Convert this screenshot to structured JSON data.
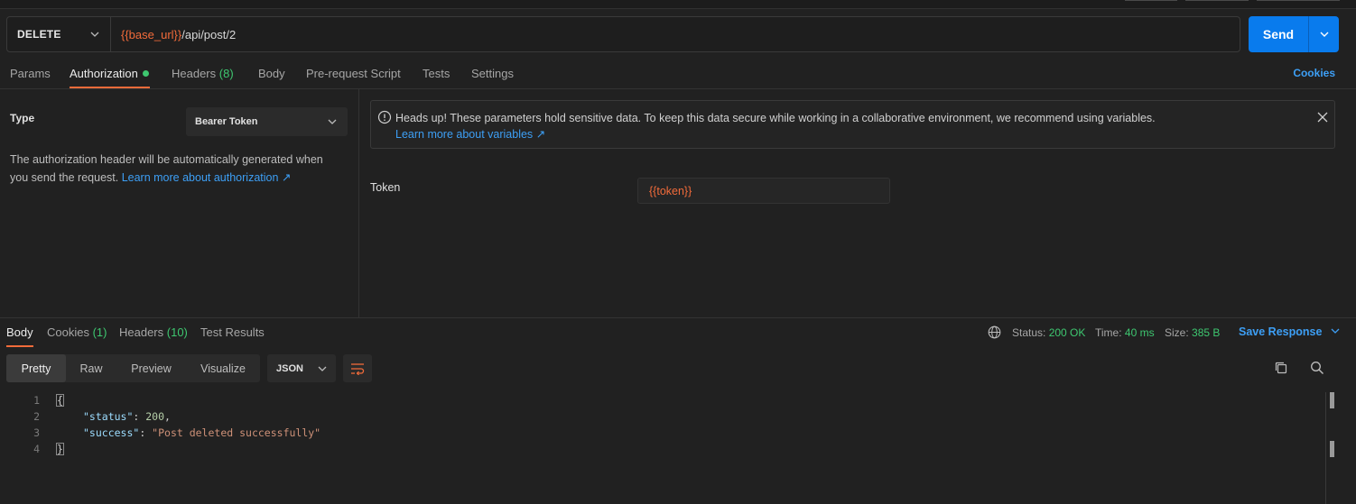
{
  "request": {
    "method": "DELETE",
    "url_var": "{{base_url}}",
    "url_path": "/api/post/2",
    "send_label": "Send"
  },
  "request_tabs": [
    {
      "label": "Params"
    },
    {
      "label": "Authorization"
    },
    {
      "label": "Headers",
      "count": "(8)"
    },
    {
      "label": "Body"
    },
    {
      "label": "Pre-request Script"
    },
    {
      "label": "Tests"
    },
    {
      "label": "Settings"
    }
  ],
  "cookies_link": "Cookies",
  "auth": {
    "type_label": "Type",
    "type_value": "Bearer Token",
    "description": "The authorization header will be automatically generated when you send the request. ",
    "learn_link": "Learn more about authorization ↗",
    "alert_text": "Heads up! These parameters hold sensitive data. To keep this data secure while working in a collaborative environment, we recommend using variables.",
    "alert_link": "Learn more about variables ↗",
    "token_label": "Token",
    "token_value": "{{token}}"
  },
  "response_tabs": [
    {
      "label": "Body"
    },
    {
      "label": "Cookies",
      "count": "(1)"
    },
    {
      "label": "Headers",
      "count": "(10)"
    },
    {
      "label": "Test Results"
    }
  ],
  "response_meta": {
    "status_label": "Status:",
    "status_value": "200 OK",
    "time_label": "Time:",
    "time_value": "40 ms",
    "size_label": "Size:",
    "size_value": "385 B",
    "save_label": "Save Response"
  },
  "view_modes": [
    "Pretty",
    "Raw",
    "Preview",
    "Visualize"
  ],
  "format": "JSON",
  "code": {
    "line_numbers": [
      "1",
      "2",
      "3",
      "4"
    ],
    "open_brace": "{",
    "close_brace": "}",
    "status_key": "\"status\"",
    "status_val": "200",
    "success_key": "\"success\"",
    "success_val": "\"Post deleted successfully\""
  },
  "colors": {
    "accent": "#f26b3a",
    "primary": "#097bed",
    "success": "#3ec770",
    "link": "#3d9ff5"
  }
}
